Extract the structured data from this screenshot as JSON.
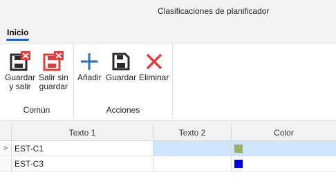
{
  "window": {
    "title": "Clasificaciones de planificador"
  },
  "ribbon": {
    "tab_label": "Inicio",
    "groups": {
      "comun": {
        "label": "Común",
        "buttons": {
          "save_exit": "Guardar\ny salir",
          "exit_nosave": "Salir sin\nguardar"
        }
      },
      "acciones": {
        "label": "Acciones",
        "buttons": {
          "add": "Añadir",
          "save": "Guardar",
          "delete": "Eliminar"
        }
      }
    },
    "icons": {
      "save_exit": "save-close-icon",
      "exit_nosave": "exit-without-saving-icon",
      "add": "plus-icon",
      "save": "floppy-disk-icon",
      "delete": "x-delete-icon"
    }
  },
  "grid": {
    "columns": [
      "Texto 1",
      "Texto 2",
      "Color"
    ],
    "rows": [
      {
        "indicator": ">",
        "texto1": "EST-C1",
        "texto2": "",
        "color": "#9bb068",
        "selected": true
      },
      {
        "indicator": "",
        "texto1": "EST-C3",
        "texto2": "",
        "color": "#0000e6",
        "selected": false
      }
    ]
  },
  "colors": {
    "accent": "#1f5fbf",
    "danger": "#e03c3c",
    "selection": "#cde6fb"
  }
}
